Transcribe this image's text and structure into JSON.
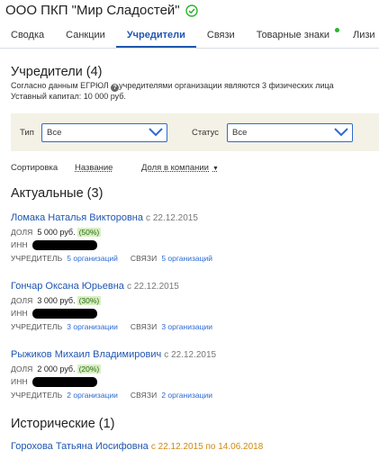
{
  "header": {
    "title": "ООО ПКП \"Мир Сладостей\""
  },
  "tabs": [
    {
      "label": "Сводка"
    },
    {
      "label": "Санкции"
    },
    {
      "label": "Учредители"
    },
    {
      "label": "Связи"
    },
    {
      "label": "Товарные знаки"
    },
    {
      "label": "Лизи"
    }
  ],
  "founders": {
    "title": "Учредители (4)",
    "description_part1": "Согласно данным ЕГРЮЛ ",
    "description_part2": "учредителями организации являются 3 физических лица",
    "capital": "Уставный капитал: 10 000 руб."
  },
  "filters": {
    "type_label": "Тип",
    "type_value": "Все",
    "status_label": "Статус",
    "status_value": "Все"
  },
  "sort": {
    "label": "Сортировка",
    "by_name": "Название",
    "by_share": "Доля в компании"
  },
  "labels": {
    "share": "ДОЛЯ",
    "inn": "ИНН",
    "founder": "УЧРЕДИТЕЛЬ",
    "links": "СВЯЗИ",
    "since_prefix": "с",
    "until_prefix": "по"
  },
  "actual": {
    "title": "Актуальные (3)",
    "people": [
      {
        "name": "Ломака Наталья Викторовна",
        "since": "22.12.2015",
        "share": "5 000 руб.",
        "pct": "(50%)",
        "founder_orgs": "5 организаций",
        "link_orgs": "5 организаций"
      },
      {
        "name": "Гончар Оксана Юрьевна",
        "since": "22.12.2015",
        "share": "3 000 руб.",
        "pct": "(30%)",
        "founder_orgs": "3 организации",
        "link_orgs": "3 организации"
      },
      {
        "name": "Рыжиков Михаил Владимирович",
        "since": "22.12.2015",
        "share": "2 000 руб.",
        "pct": "(20%)",
        "founder_orgs": "2 организации",
        "link_orgs": "2 организации"
      }
    ]
  },
  "historical": {
    "title": "Исторические (1)",
    "people": [
      {
        "name": "Горохова Татьяна Иосифовна",
        "since": "22.12.2015",
        "until": "14.06.2018"
      }
    ]
  },
  "colors": {
    "accent": "#1f56b0",
    "verified": "#2bb32b",
    "historical_date": "#d08a12",
    "filter_bg": "#f4f1e6"
  }
}
